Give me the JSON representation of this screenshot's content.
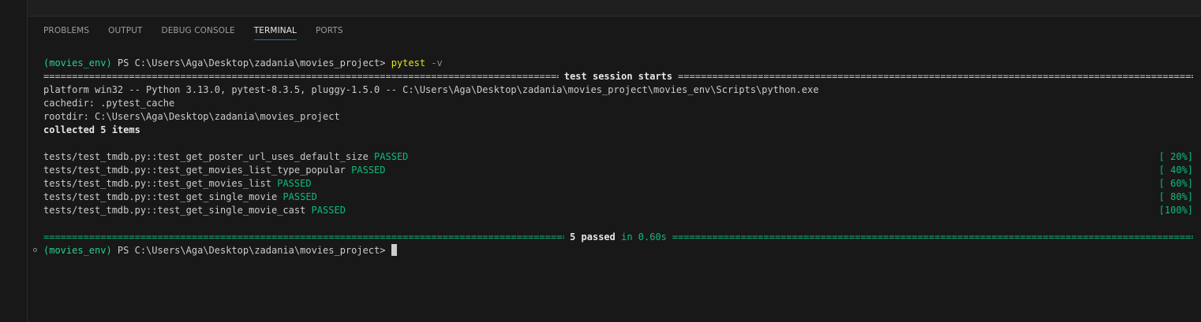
{
  "tabs": [
    {
      "label": "PROBLEMS"
    },
    {
      "label": "OUTPUT"
    },
    {
      "label": "DEBUG CONSOLE"
    },
    {
      "label": "TERMINAL"
    },
    {
      "label": "PORTS"
    }
  ],
  "terminal": {
    "prompt_env": "(movies_env)",
    "prompt_path": " PS C:\\Users\\Aga\\Desktop\\zadania\\movies_project> ",
    "command": "pytest",
    "command_args": " -v",
    "session_header": "test session starts",
    "platform_line": "platform win32 -- Python 3.13.0, pytest-8.3.5, pluggy-1.5.0 -- C:\\Users\\Aga\\Desktop\\zadania\\movies_project\\movies_env\\Scripts\\python.exe",
    "cachedir_line": "cachedir: .pytest_cache",
    "rootdir_line": "rootdir: C:\\Users\\Aga\\Desktop\\zadania\\movies_project",
    "collected_line": "collected 5 items",
    "tests": [
      {
        "name": "tests/test_tmdb.py::test_get_poster_url_uses_default_size",
        "status": "PASSED",
        "progress": "[ 20%]"
      },
      {
        "name": "tests/test_tmdb.py::test_get_movies_list_type_popular",
        "status": "PASSED",
        "progress": "[ 40%]"
      },
      {
        "name": "tests/test_tmdb.py::test_get_movies_list",
        "status": "PASSED",
        "progress": "[ 60%]"
      },
      {
        "name": "tests/test_tmdb.py::test_get_single_movie",
        "status": "PASSED",
        "progress": "[ 80%]"
      },
      {
        "name": "tests/test_tmdb.py::test_get_single_movie_cast",
        "status": "PASSED",
        "progress": "[100%]"
      }
    ],
    "summary_passed": "5 passed",
    "summary_time": " in 0.60s"
  },
  "colors": {
    "background": "#181818",
    "prompt_green": "#23d18b",
    "command_yellow": "#e5e510",
    "passed_green": "#0dbc79",
    "active_tab_underline": "#0078d4"
  }
}
